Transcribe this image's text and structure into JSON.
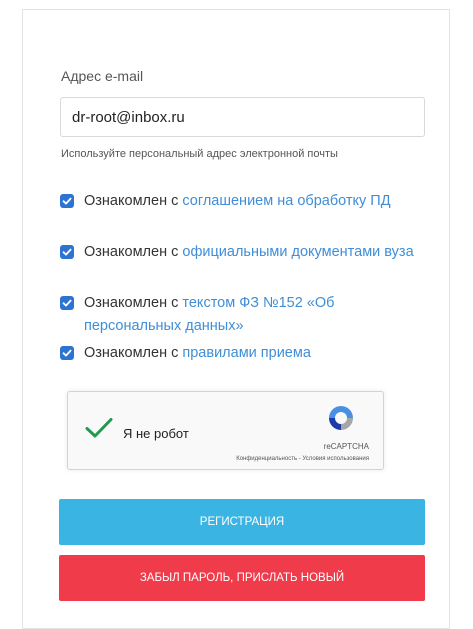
{
  "form": {
    "email_label": "Адрес e-mail",
    "email_value": "dr-root@inbox.ru",
    "email_hint": "Используйте персональный адрес электронной почты",
    "checkbox_color": "#2d73d2",
    "link_color": "#3f8ed7",
    "agreements": [
      {
        "prefix": "Ознакомлен с ",
        "link": "соглашением на обработку ПД",
        "checked": true
      },
      {
        "prefix": "Ознакомлен с ",
        "link": "официальными документами вуза",
        "checked": true
      },
      {
        "prefix": "Ознакомлен с ",
        "link": "текстом ФЗ №152 «Об персональных данных»",
        "checked": true
      },
      {
        "prefix": "Ознакомлен с ",
        "link": "правилами приема",
        "checked": true
      }
    ]
  },
  "captcha": {
    "label": "Я не робот",
    "brand": "reCAPTCHA",
    "links": "Конфиденциальность - Условия использования",
    "checked": true
  },
  "buttons": {
    "register_label": "РЕГИСТРАЦИЯ",
    "register_color": "#39b4e3",
    "forgot_label": "ЗАБЫЛ ПАРОЛЬ, ПРИСЛАТЬ НОВЫЙ",
    "forgot_color": "#f03b4b"
  }
}
